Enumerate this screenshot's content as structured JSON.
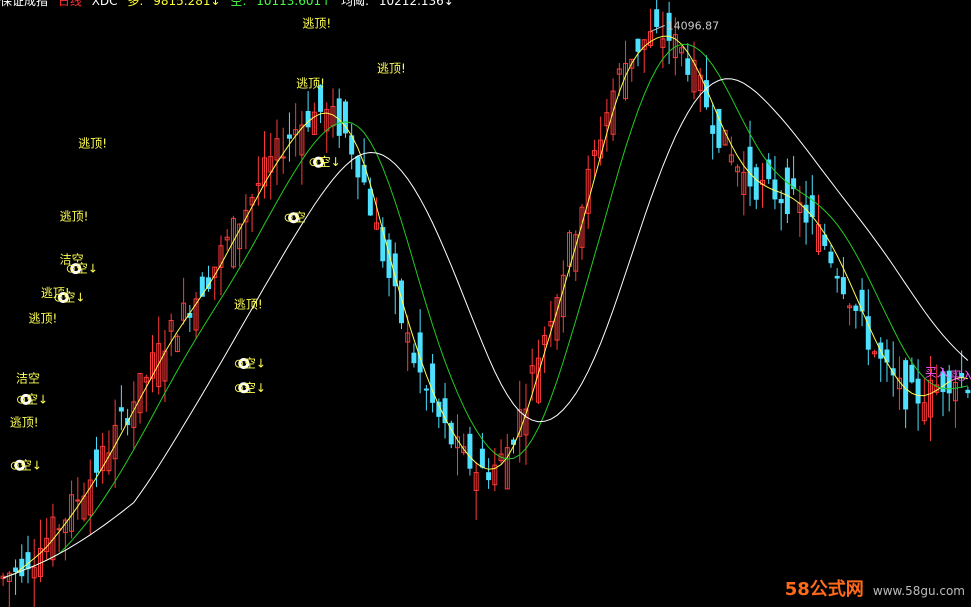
{
  "header": {
    "title": "保证成指",
    "line_label": "日线",
    "indicator": "XDC",
    "duo_label": "多:",
    "duo_value": "9815.281↓",
    "kong_label": "空:",
    "kong_value": "10113.601↑",
    "avg_label": "均阈:",
    "avg_value": "10212.136↓"
  },
  "watermark": {
    "logo": "58公式网",
    "url": "www.58gu.com"
  },
  "colors": {
    "bg": "#000000",
    "up": "#ff3a3a",
    "down": "#4ee0ff",
    "ma_fast": "#ffff55",
    "ma_mid": "#22cc22",
    "ma_slow": "#ffffff",
    "signal": "#ffff55",
    "signal_alt": "#ff55ff"
  },
  "chart_data": {
    "type": "candlestick",
    "high_label": "14096.87",
    "y_range": [
      9200,
      14300
    ],
    "x": "bar index 0..155",
    "close": [
      9390,
      9430,
      9470,
      9520,
      9560,
      9600,
      9660,
      9720,
      9790,
      9860,
      9930,
      10010,
      10090,
      10170,
      10260,
      10350,
      10440,
      10540,
      10640,
      10740,
      10840,
      10940,
      11040,
      11140,
      11240,
      11340,
      11440,
      11520,
      11600,
      11680,
      11760,
      11840,
      11920,
      12000,
      12100,
      12200,
      12300,
      12400,
      12500,
      12600,
      12700,
      12800,
      12900,
      12980,
      13060,
      13140,
      13220,
      13280,
      13340,
      13380,
      13410,
      13420,
      13400,
      13360,
      13300,
      13220,
      13120,
      12980,
      12800,
      12600,
      12400,
      12190,
      11990,
      11800,
      11620,
      11450,
      11290,
      11140,
      11000,
      10880,
      10770,
      10670,
      10580,
      10500,
      10430,
      10380,
      10340,
      10320,
      10330,
      10360,
      10420,
      10520,
      10650,
      10800,
      10980,
      11160,
      11340,
      11520,
      11700,
      11880,
      12070,
      12260,
      12450,
      12640,
      12840,
      13040,
      13240,
      13430,
      13600,
      13740,
      13850,
      13930,
      13990,
      14030,
      14060,
      14080,
      14080,
      14060,
      14010,
      13940,
      13850,
      13740,
      13620,
      13490,
      13360,
      13240,
      13130,
      13030,
      12950,
      12880,
      12830,
      12790,
      12760,
      12740,
      12720,
      12700,
      12670,
      12630,
      12580,
      12520,
      12450,
      12370,
      12280,
      12180,
      12070,
      11950,
      11830,
      11700,
      11580,
      11460,
      11350,
      11250,
      11160,
      11080,
      11020,
      10980,
      10960,
      10960,
      10980,
      11010,
      11050,
      11090,
      11120,
      11130,
      11120,
      11090
    ],
    "series": [
      {
        "name": ""
      },
      {
        "name": ""
      },
      {
        "name": ""
      }
    ],
    "signals": [
      {
        "text": "逃顶!",
        "bar": 62,
        "y": 13760
      },
      {
        "text": "逃顶!",
        "bar": 14,
        "y": 13110
      },
      {
        "text": "逃顶!",
        "bar": 11,
        "y": 12480
      },
      {
        "text": "洁空",
        "bar": 11,
        "y": 12110
      },
      {
        "text": "逃顶!",
        "bar": 8,
        "y": 11820
      },
      {
        "text": "逃顶!",
        "bar": 6,
        "y": 11600
      },
      {
        "text": "洁空",
        "bar": 4,
        "y": 11080
      },
      {
        "text": "⊙空↓",
        "bar": 4,
        "y": 10900
      },
      {
        "text": "逃顶!",
        "bar": 3,
        "y": 10700
      },
      {
        "text": "⊙空↓",
        "bar": 3,
        "y": 10330
      },
      {
        "text": "⊙空↓",
        "bar": 12,
        "y": 12030
      },
      {
        "text": "⊙空↓",
        "bar": 10,
        "y": 11780
      },
      {
        "text": "逃顶!",
        "bar": 39,
        "y": 11720
      },
      {
        "text": "⊙空↓",
        "bar": 39,
        "y": 11210
      },
      {
        "text": "⊙空↓",
        "bar": 39,
        "y": 11000
      },
      {
        "text": "⊙空",
        "bar": 47,
        "y": 12470
      },
      {
        "text": "逃顶!",
        "bar": 49,
        "y": 13630
      },
      {
        "text": "逃顶!",
        "bar": 50,
        "y": 14150
      },
      {
        "text": "⊙空↓",
        "bar": 51,
        "y": 12950
      },
      {
        "text": "买入",
        "bar": 150,
        "y": 11130
      },
      {
        "text": "买入",
        "bar": 154,
        "y": 11100
      }
    ]
  }
}
